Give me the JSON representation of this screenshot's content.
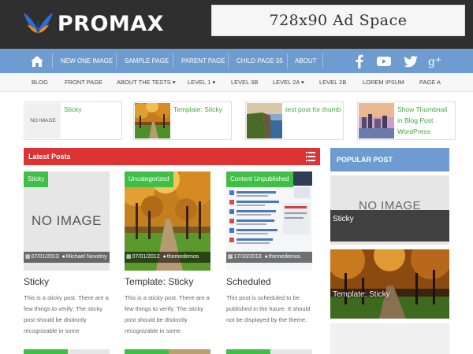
{
  "brand": {
    "logo_text_bold": "PRO",
    "logo_text_thin": "MAX"
  },
  "ad": {
    "label": "728x90 Ad Space"
  },
  "main_nav": {
    "items": [
      {
        "label": "NEW ONE IMAGE"
      },
      {
        "label": "SAMPLE PAGE"
      },
      {
        "label": "PARENT PAGE"
      },
      {
        "label": "CHILD PAGE 05"
      },
      {
        "label": "ABOUT"
      }
    ],
    "social": [
      "facebook-icon",
      "youtube-icon",
      "twitter-icon",
      "google-plus-icon"
    ]
  },
  "sub_nav": {
    "items": [
      {
        "label": "BLOG"
      },
      {
        "label": "FRONT PAGE"
      },
      {
        "label": "ABOUT THE TESTS ▾"
      },
      {
        "label": "LEVEL 1 ▾"
      },
      {
        "label": "LEVEL 3B"
      },
      {
        "label": "LEVEL 2A ▾"
      },
      {
        "label": "LEVEL 2B"
      },
      {
        "label": "LOREM IPSUM"
      },
      {
        "label": "PAGE A"
      }
    ]
  },
  "featured": [
    {
      "title": "Sticky",
      "thumb_label": "NO IMAGE"
    },
    {
      "title": "Template: Sticky"
    },
    {
      "title": "test post for thumb"
    },
    {
      "title": "Show Thumbnail in Blog Post WordPress"
    }
  ],
  "latest": {
    "heading": "Latest Posts",
    "posts": [
      {
        "category": "Sticky",
        "no_image": "NO IMAGE",
        "date": "07/01/2013",
        "author": "Michael Novotny",
        "title": "Sticky",
        "excerpt": "This is a sticky post. There are a few things to verify: The sticky post should be distinctly recognizable in some"
      },
      {
        "category": "Uncategorized",
        "date": "07/01/2012",
        "author": "themedemos",
        "title": "Template: Sticky",
        "excerpt": "This is a sticky post. There are a few things to verify: The sticky post should be distinctly recognizable in some"
      },
      {
        "category": "Content  Unpublished",
        "date": "17/10/2013",
        "author": "themedemos",
        "title": "Scheduled",
        "excerpt": "This post is scheduled to be published in the future. It should not be displayed by the theme."
      }
    ]
  },
  "popular": {
    "heading": "POPULAR POST",
    "posts": [
      {
        "title": "Sticky",
        "no_image": "NO IMAGE"
      },
      {
        "title": "Template: Sticky"
      }
    ]
  },
  "colors": {
    "header_bg": "#2f2f2f",
    "nav_blue": "#6e9cd0",
    "accent_red": "#dd3333",
    "accent_green": "#3fbf46",
    "link_green": "#3daa3a"
  }
}
